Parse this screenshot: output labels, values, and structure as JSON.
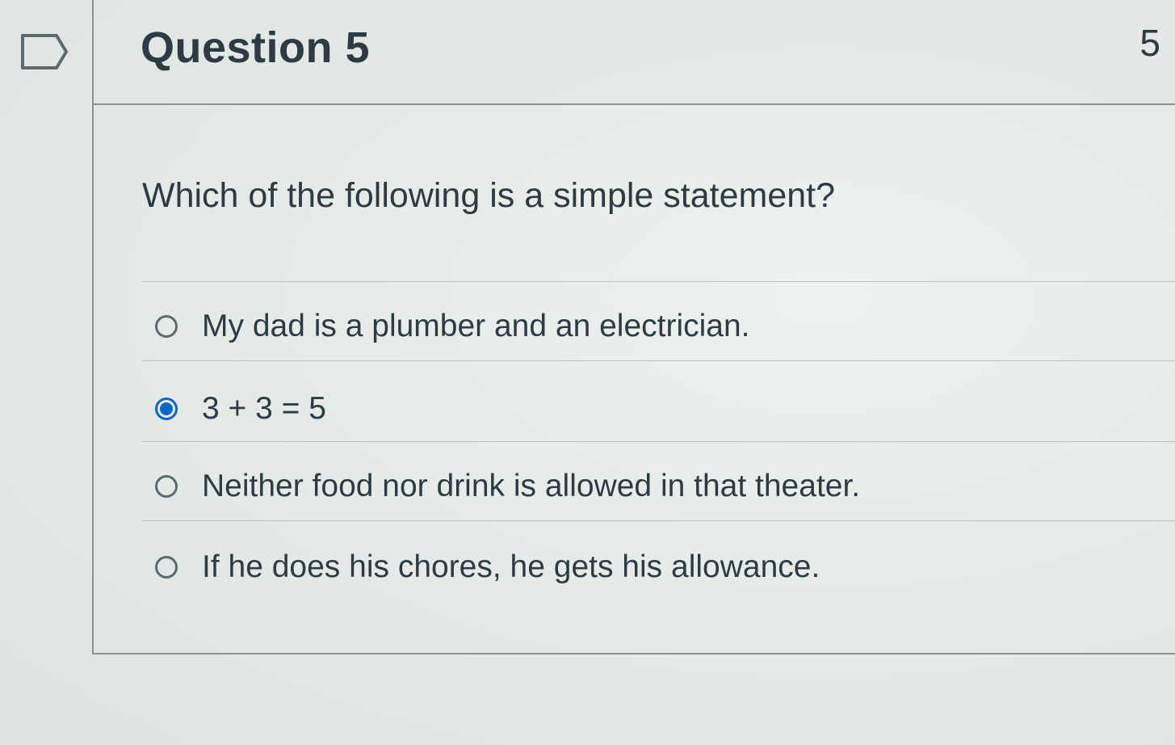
{
  "question": {
    "title": "Question 5",
    "points": "5",
    "prompt": "Which of the following is a simple statement?"
  },
  "answers": [
    {
      "label": "My dad is a plumber and an electrician.",
      "selected": false
    },
    {
      "label": "3 + 3 = 5",
      "selected": true
    },
    {
      "label": "Neither food nor drink is allowed in that theater.",
      "selected": false
    },
    {
      "label": "If he does his chores, he gets his allowance.",
      "selected": false
    }
  ],
  "colors": {
    "text": "#2d3b45",
    "selected_radio": "#0a66c8",
    "border": "#8a9590"
  },
  "icons": {
    "flag": "flag-outline-icon"
  }
}
